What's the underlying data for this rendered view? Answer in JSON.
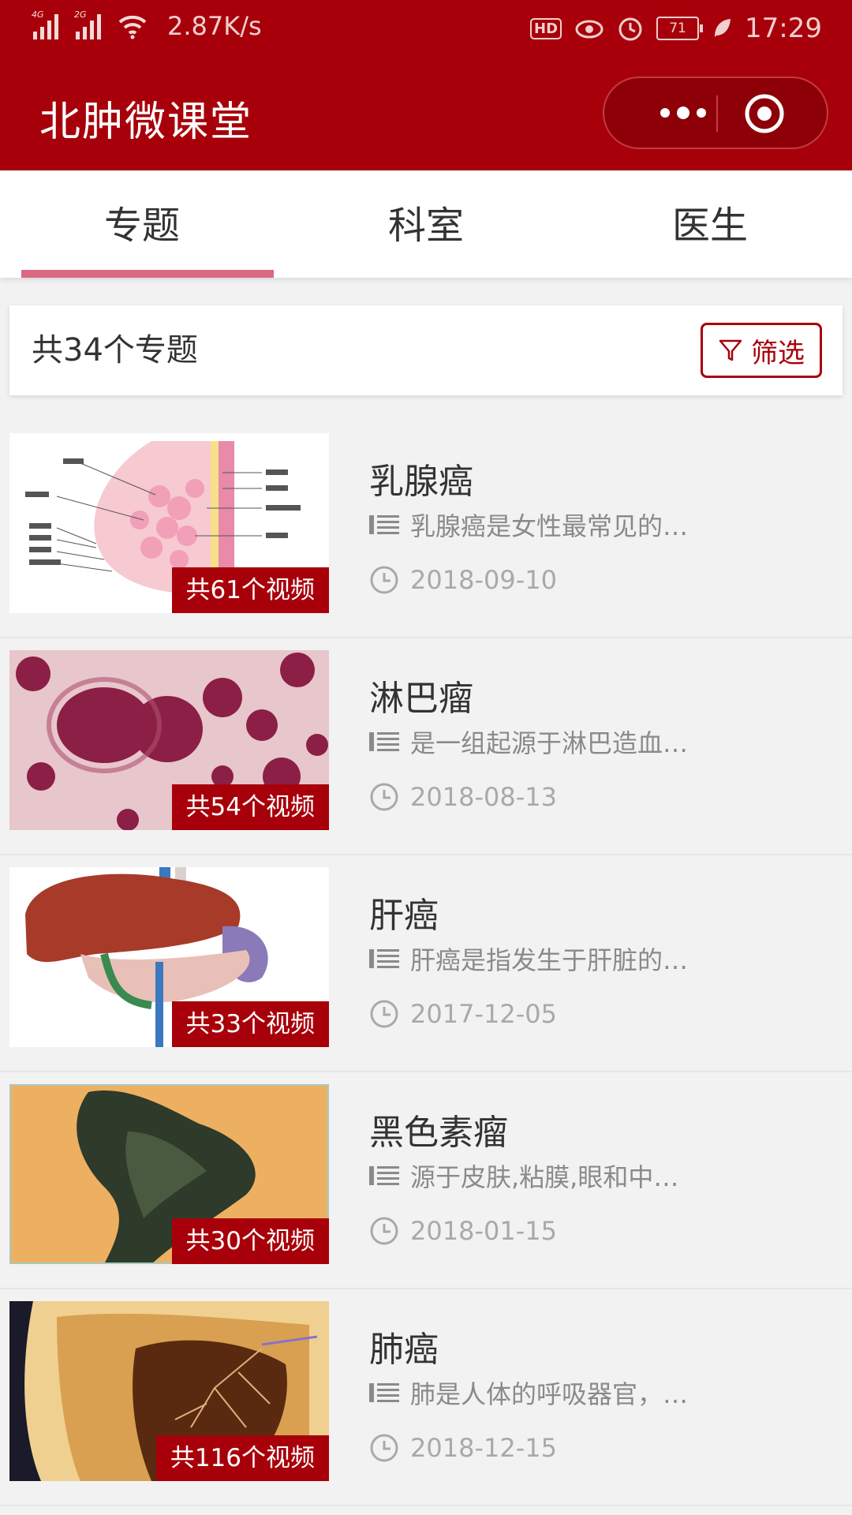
{
  "status_bar": {
    "net1": "4G",
    "net2": "2G",
    "speed": "2.87K/s",
    "hd": "HD",
    "battery": "71",
    "time": "17:29"
  },
  "header": {
    "title": "北肿微课堂"
  },
  "tabs": [
    {
      "label": "专题",
      "active": true
    },
    {
      "label": "科室",
      "active": false
    },
    {
      "label": "医生",
      "active": false
    }
  ],
  "filter": {
    "count_text": "共34个专题",
    "button_label": "筛选"
  },
  "topics": [
    {
      "name": "乳腺癌",
      "desc": "乳腺癌是女性最常见的…",
      "date": "2018-09-10",
      "video_count": "共61个视频",
      "thumb_icon": "breast-anatomy-image"
    },
    {
      "name": "淋巴瘤",
      "desc": "是一组起源于淋巴造血…",
      "date": "2018-08-13",
      "video_count": "共54个视频",
      "thumb_icon": "lymphoma-cells-image"
    },
    {
      "name": "肝癌",
      "desc": "肝癌是指发生于肝脏的…",
      "date": "2017-12-05",
      "video_count": "共33个视频",
      "thumb_icon": "liver-anatomy-image"
    },
    {
      "name": "黑色素瘤",
      "desc": "源于皮肤,粘膜,眼和中…",
      "date": "2018-01-15",
      "video_count": "共30个视频",
      "thumb_icon": "melanoma-skin-image"
    },
    {
      "name": "肺癌",
      "desc": "肺是人体的呼吸器官，…",
      "date": "2018-12-15",
      "video_count": "共116个视频",
      "thumb_icon": "lung-xray-image"
    }
  ],
  "colors": {
    "brand": "#a8000a",
    "tab_indicator": "#d96a84"
  }
}
